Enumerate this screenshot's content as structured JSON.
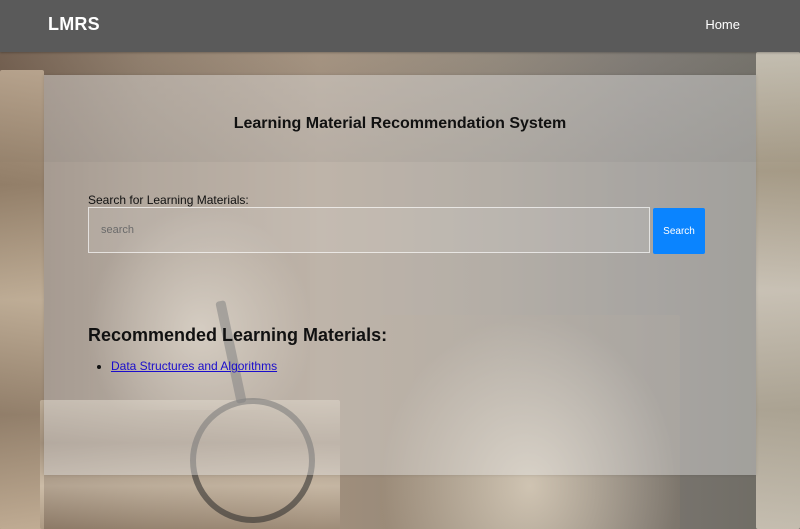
{
  "navbar": {
    "brand": "LMRS",
    "links": [
      {
        "label": "Home"
      }
    ]
  },
  "main": {
    "title": "Learning Material Recommendation System",
    "search": {
      "label": "Search for Learning Materials:",
      "placeholder": "search",
      "value": "",
      "button_label": "Search"
    },
    "recommendations": {
      "heading": "Recommended Learning Materials:",
      "items": [
        {
          "label": "Data Structures and Algorithms"
        }
      ]
    }
  },
  "colors": {
    "navbar_bg": "#5a5a5a",
    "search_button_bg": "#0a84ff",
    "link": "#1a0dcc"
  }
}
